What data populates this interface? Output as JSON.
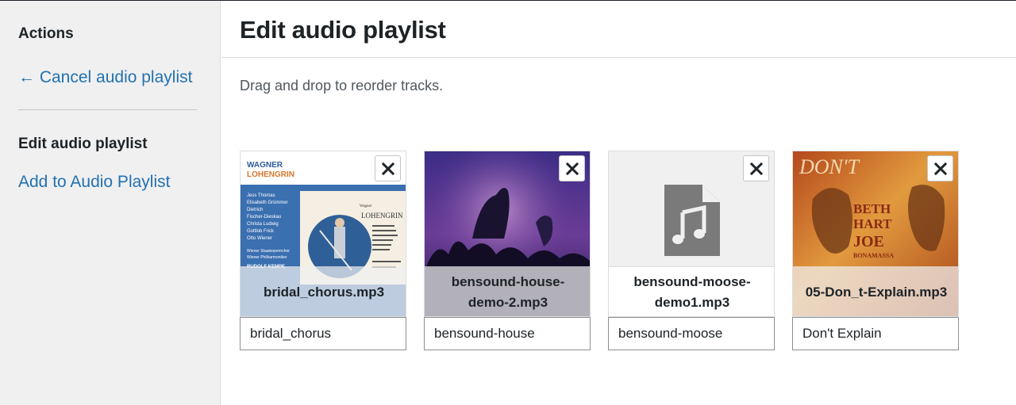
{
  "sidebar": {
    "heading": "Actions",
    "cancel_link": "← Cancel audio playlist",
    "current_view": "Edit audio playlist",
    "add_link": "Add to Audio Playlist"
  },
  "main": {
    "title": "Edit audio playlist",
    "instructions": "Drag and drop to reorder tracks."
  },
  "tracks": [
    {
      "filename": "bridal_chorus.mp3",
      "title": "bridal_chorus",
      "art": {
        "top_line": "WAGNER",
        "bottom_line": "LOHENGRIN",
        "cast": [
          "Jess Thomas",
          "Elisabeth Grümmer",
          "Dietrich",
          "Fischer-Dieskau",
          "Christa Ludwig",
          "Gottlob Frick",
          "Otto Wiener"
        ],
        "ensemble": [
          "Wiener Staatsopernchor",
          "Wiener Philharmoniker"
        ],
        "conductor": "RUDOLF KEMPE",
        "panel_title": "Wagner",
        "panel_opera": "LOHENGRIN"
      }
    },
    {
      "filename": "bensound-house-demo-2.mp3",
      "title": "bensound-house"
    },
    {
      "filename": "bensound-moose-demo1.mp3",
      "title": "bensound-moose"
    },
    {
      "filename": "05-Don_t-Explain.mp3",
      "title": "Don't Explain",
      "art": {
        "line1": "BETH",
        "line2": "HART",
        "line3": "JOE",
        "line4": "BONAMASSA",
        "script": "DON'T"
      }
    }
  ],
  "colors": {
    "link": "#2271b1",
    "sidebar_bg": "#f0f0f1",
    "heading": "#1d2327",
    "wagner_blue": "#3a6fb0"
  },
  "icons": {
    "remove": "close-icon",
    "generic_audio": "audio-file-icon"
  }
}
